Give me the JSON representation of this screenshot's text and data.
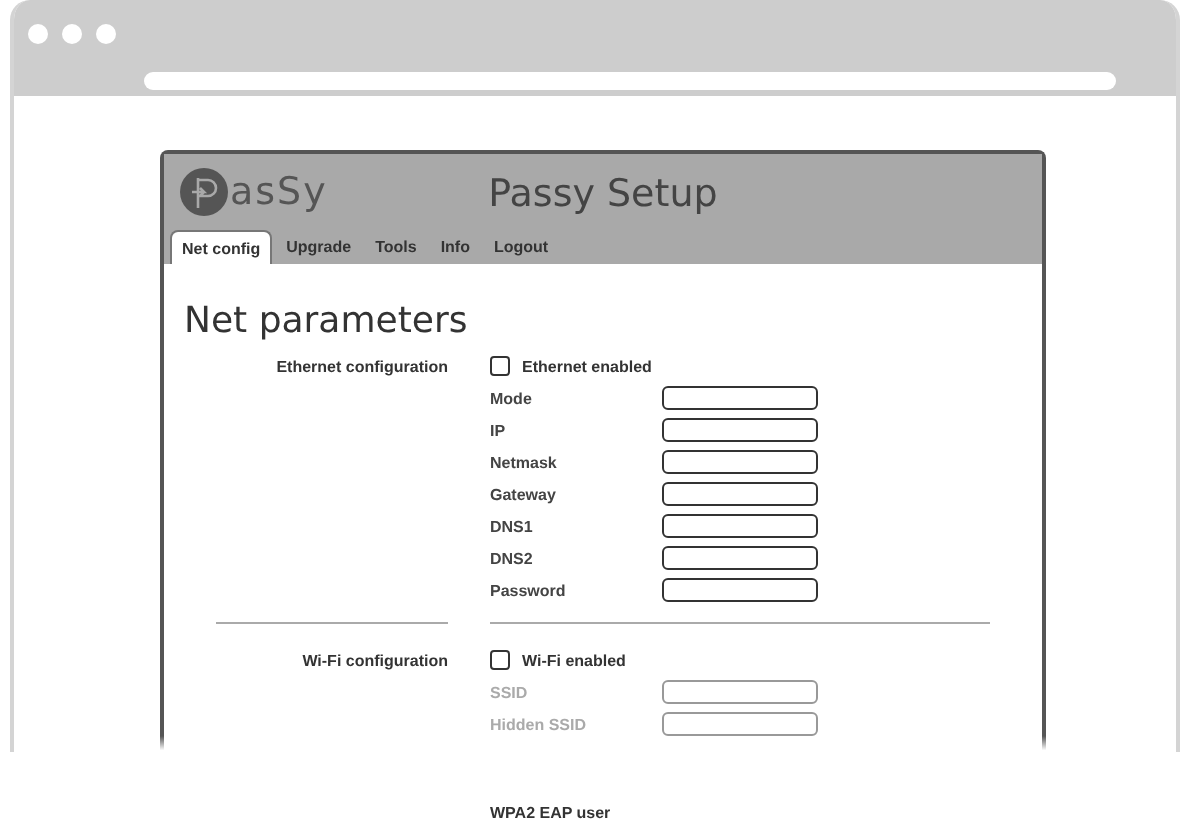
{
  "app": {
    "logo_text": "asSy",
    "title": "Passy Setup",
    "tabs": [
      {
        "label": "Net config",
        "selected": true
      },
      {
        "label": "Upgrade",
        "selected": false
      },
      {
        "label": "Tools",
        "selected": false
      },
      {
        "label": "Info",
        "selected": false
      },
      {
        "label": "Logout",
        "selected": false
      }
    ],
    "heading": "Net parameters",
    "sections": [
      {
        "label": "Ethernet configuration",
        "toggle": {
          "label": "Ethernet enabled",
          "checked": false
        },
        "fields": [
          {
            "label": "Mode",
            "disabled": false
          },
          {
            "label": "IP",
            "disabled": false
          },
          {
            "label": "Netmask",
            "disabled": false
          },
          {
            "label": "Gateway",
            "disabled": false
          },
          {
            "label": "DNS1",
            "disabled": false
          },
          {
            "label": "DNS2",
            "disabled": false
          },
          {
            "label": "Password",
            "disabled": false
          }
        ]
      },
      {
        "label": "Wi-Fi configuration",
        "toggle": {
          "label": "Wi-Fi enabled",
          "checked": false
        },
        "fields": [
          {
            "label": "SSID",
            "disabled": true
          },
          {
            "label": "Hidden SSID",
            "disabled": true
          }
        ]
      }
    ]
  },
  "below_fade": {
    "label": "WPA2 EAP user"
  }
}
